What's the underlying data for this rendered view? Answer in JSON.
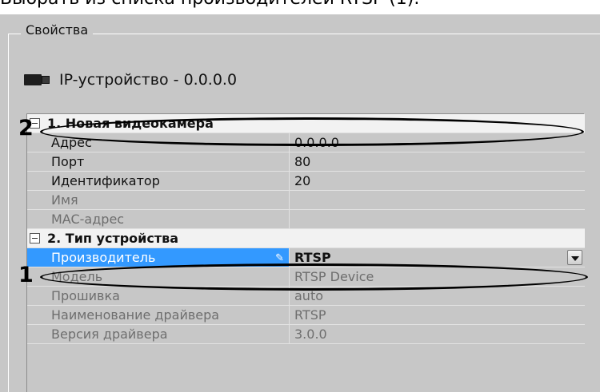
{
  "header_caption": "Выбрать из списка производителей RTSP (1).",
  "panel": {
    "group_title": "Свойства",
    "device_title": "IP-устройство - 0.0.0.0"
  },
  "sections": [
    {
      "label": "1. Новая видеокамера",
      "rows": [
        {
          "name": "Адрес",
          "value": "0.0.0.0"
        },
        {
          "name": "Порт",
          "value": "80"
        },
        {
          "name": "Идентификатор",
          "value": "20"
        },
        {
          "name": "Имя",
          "value": ""
        },
        {
          "name": "MAC-адрес",
          "value": ""
        }
      ]
    },
    {
      "label": "2. Тип устройства",
      "rows": [
        {
          "name": "Производитель",
          "value": "RTSP"
        },
        {
          "name": "Модель",
          "value": "RTSP Device"
        },
        {
          "name": "Прошивка",
          "value": "auto"
        },
        {
          "name": "Наименование драйвера",
          "value": "RTSP"
        },
        {
          "name": "Версия драйвера",
          "value": "3.0.0"
        }
      ]
    }
  ],
  "callouts": [
    "1",
    "2"
  ],
  "icons": {
    "camera": "camera-icon",
    "collapse": "minus-box-icon",
    "edit": "pencil-icon",
    "dropdown": "chevron-down-icon"
  },
  "colors": {
    "selection": "#3399ff",
    "panel_bg": "#c7c7c7",
    "section_bg": "#f2f2f2"
  }
}
